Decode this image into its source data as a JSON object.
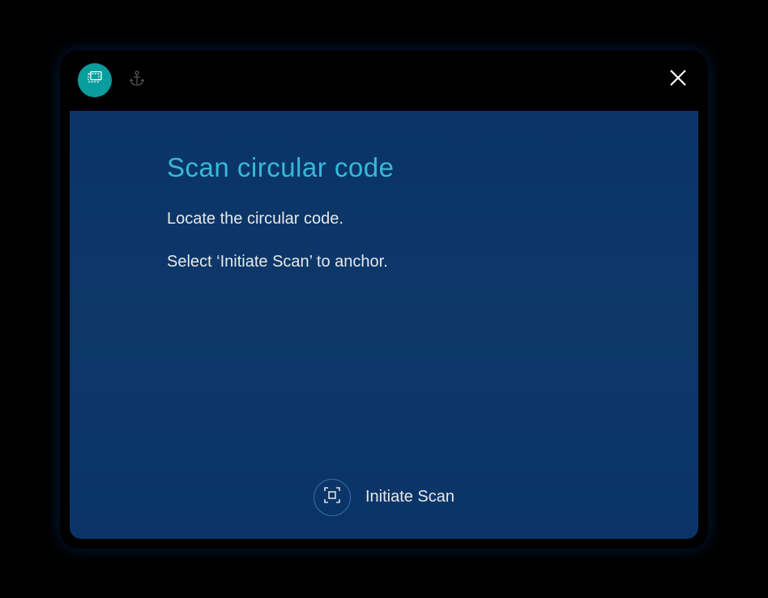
{
  "dialog": {
    "heading": "Scan circular code",
    "line1": "Locate the circular code.",
    "line2": "Select ‘Initiate Scan’ to anchor."
  },
  "action": {
    "label": "Initiate Scan"
  },
  "tabs": {
    "active_icon": "hologram-icon",
    "inactive_icon": "anchor-icon"
  }
}
